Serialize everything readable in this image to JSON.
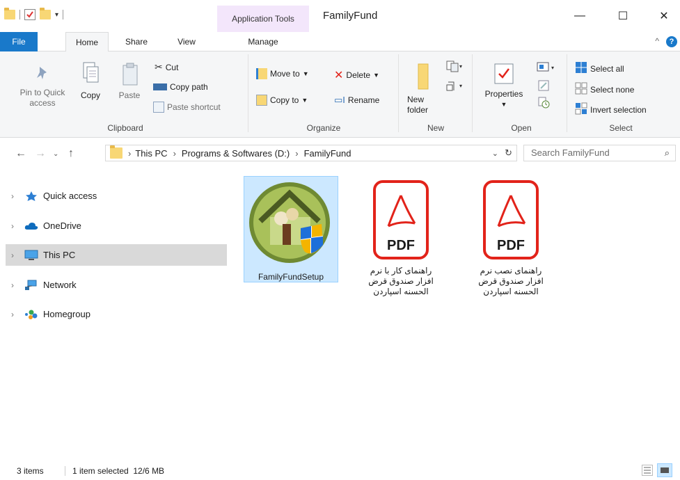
{
  "window": {
    "title": "FamilyFund",
    "context_tab_group": "Application Tools",
    "minimize": "—",
    "maximize": "☐",
    "close": "✕"
  },
  "tabs": [
    {
      "label": "File"
    },
    {
      "label": "Home"
    },
    {
      "label": "Share"
    },
    {
      "label": "View"
    },
    {
      "label": "Manage"
    }
  ],
  "ribbon": {
    "clipboard": {
      "label": "Clipboard",
      "pin": "Pin to Quick access",
      "copy": "Copy",
      "paste": "Paste",
      "cut": "Cut",
      "copy_path": "Copy path",
      "paste_shortcut": "Paste shortcut"
    },
    "organize": {
      "label": "Organize",
      "move_to": "Move to",
      "copy_to": "Copy to",
      "delete": "Delete",
      "rename": "Rename"
    },
    "new": {
      "label": "New",
      "new_folder": "New folder"
    },
    "open": {
      "label": "Open",
      "properties": "Properties"
    },
    "select": {
      "label": "Select",
      "select_all": "Select all",
      "select_none": "Select none",
      "invert": "Invert selection"
    }
  },
  "address": {
    "crumbs": [
      "This PC",
      "Programs & Softwares (D:)",
      "FamilyFund"
    ],
    "search_placeholder": "Search FamilyFund"
  },
  "nav": [
    {
      "label": "Quick access",
      "icon": "star-icon"
    },
    {
      "label": "OneDrive",
      "icon": "cloud-icon"
    },
    {
      "label": "This PC",
      "icon": "computer-icon",
      "selected": true
    },
    {
      "label": "Network",
      "icon": "network-icon"
    },
    {
      "label": "Homegroup",
      "icon": "homegroup-icon"
    }
  ],
  "files": [
    {
      "name": "FamilyFundSetup",
      "type": "exe",
      "selected": true
    },
    {
      "name": "راهنمای کار با نرم افزار صندوق قرض الحسنه اسپاردن",
      "type": "pdf",
      "icon_text": "PDF"
    },
    {
      "name": "راهنمای نصب نرم افزار صندوق قرض الحسنه اسپاردن",
      "type": "pdf",
      "icon_text": "PDF"
    }
  ],
  "status": {
    "items": "3 items",
    "selected": "1 item selected  12/6 MB"
  },
  "colors": {
    "accent": "#1979ca",
    "selection": "#cce8ff",
    "pdf_red": "#e2231a"
  }
}
